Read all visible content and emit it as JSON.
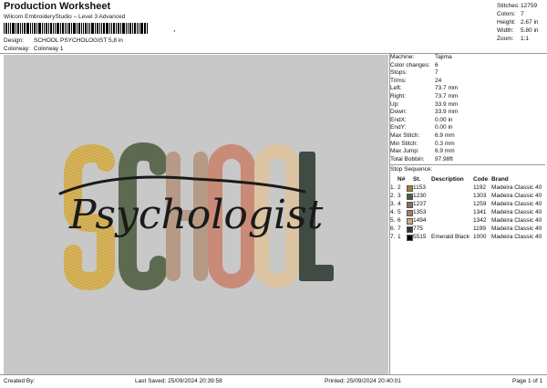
{
  "header": {
    "title": "Production Worksheet",
    "subtitle": "Wilcom EmbroideryStudio – Level 3 Advanced",
    "barcode_suffix": ",",
    "design_label": "Design:",
    "design_value": "SCHOOL PSYCHOLOGIST 5,8 in",
    "colorway_label": "Colorway:",
    "colorway_value": "Colorway 1"
  },
  "top_stats": [
    {
      "label": "Stitches:",
      "value": "12759"
    },
    {
      "label": "Colors:",
      "value": "7"
    },
    {
      "label": "Height:",
      "value": "2.67 in"
    },
    {
      "label": "Width:",
      "value": "5.80 in"
    },
    {
      "label": "Zoom:",
      "value": "1:1"
    }
  ],
  "design": {
    "letters": [
      "S",
      "C",
      "H",
      "O",
      "O",
      "L"
    ],
    "script": "Psychologist",
    "background": "#c8c8c8",
    "letter_colors": [
      "#cfa94a",
      "#5c6b50",
      "#b69a85",
      "#c98b78",
      "#dcc3a1",
      "#3f4b43"
    ]
  },
  "properties": [
    {
      "label": "Machine:",
      "value": "Tajima"
    },
    {
      "label": "Color changes:",
      "value": "6"
    },
    {
      "label": "Stops:",
      "value": "7"
    },
    {
      "label": "Trims:",
      "value": "24"
    },
    {
      "label": "Left:",
      "value": "73.7 mm"
    },
    {
      "label": "Right:",
      "value": "73.7 mm"
    },
    {
      "label": "Up:",
      "value": "33.9 mm"
    },
    {
      "label": "Down:",
      "value": "33.9 mm"
    },
    {
      "label": "EndX:",
      "value": "0.00 in"
    },
    {
      "label": "EndY:",
      "value": "0.00 in"
    },
    {
      "label": "Max Stitch:",
      "value": "6.9 mm"
    },
    {
      "label": "Min Stitch:",
      "value": "0.3 mm"
    },
    {
      "label": "Max Jump:",
      "value": "6.9 mm"
    },
    {
      "label": "Total Bobbin:",
      "value": "97.98ft"
    }
  ],
  "stop_sequence": {
    "title": "Stop Sequence:",
    "headers": {
      "num": "N#",
      "st": "St.",
      "desc": "Description",
      "code": "Code",
      "brand": "Brand"
    },
    "rows": [
      {
        "idx": "1.",
        "num": "2",
        "color": "#a08030",
        "st": "1153",
        "desc": "",
        "code": "1192",
        "brand": "Madeira Classic 40"
      },
      {
        "idx": "2.",
        "num": "3",
        "color": "#4f5a45",
        "st": "1230",
        "desc": "",
        "code": "1303",
        "brand": "Madeira Classic 40"
      },
      {
        "idx": "3.",
        "num": "4",
        "color": "#8a6f5c",
        "st": "1237",
        "desc": "",
        "code": "1259",
        "brand": "Madeira Classic 40"
      },
      {
        "idx": "4.",
        "num": "5",
        "color": "#b07868",
        "st": "1353",
        "desc": "",
        "code": "1341",
        "brand": "Madeira Classic 40"
      },
      {
        "idx": "5.",
        "num": "6",
        "color": "#c8a888",
        "st": "1494",
        "desc": "",
        "code": "1342",
        "brand": "Madeira Classic 40"
      },
      {
        "idx": "6.",
        "num": "7",
        "color": "#2f3a33",
        "st": "775",
        "desc": "",
        "code": "1199",
        "brand": "Madeira Classic 40"
      },
      {
        "idx": "7.",
        "num": "1",
        "color": "#000000",
        "st": "5515",
        "desc": "Emerald Black",
        "code": "1000",
        "brand": "Madeira Classic 40"
      }
    ]
  },
  "footer": {
    "created": "Created By:",
    "saved": "Last Saved: 25/09/2024 20:39:58",
    "printed": "Printed: 25/09/2024 20:40:01",
    "page": "Page 1 of 1"
  }
}
